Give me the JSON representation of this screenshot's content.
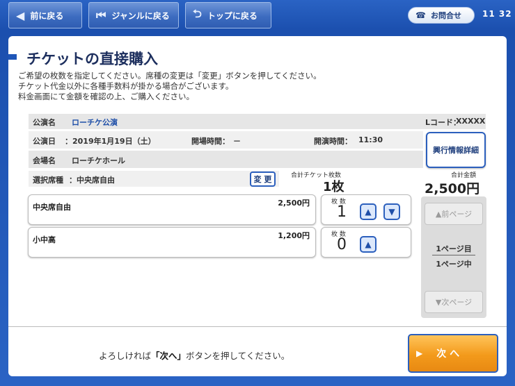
{
  "topbar": {
    "back_label": "前に戻る",
    "genre_back_label": "ジャンルに戻る",
    "top_back_label": "トップに戻る",
    "contact_label": "お問合せ",
    "clock": "11 32"
  },
  "page": {
    "title": "チケットの直接購入",
    "instructions": [
      "ご希望の枚数を指定してください。席種の変更は「変更」ボタンを押してください。",
      "チケット代金以外に各種手数料が掛かる場合がございます。",
      "料金画面にて金額を確認の上、ご購入ください。"
    ]
  },
  "event": {
    "name_label": "公演名",
    "name": "ローチケ公演",
    "lcode_label": "Lコード：",
    "lcode": "XXXXX",
    "date_label": "公演日",
    "date": "：2019年1月19日（土）",
    "open_label": "開場時間：",
    "open_time": "－",
    "start_label": "開演時間：",
    "start_time": "11:30",
    "venue_label": "会場名",
    "venue": "ローチケホール",
    "seat_label": "選択席種",
    "seat": "：中央席自由",
    "detail_button": "興行情報詳細",
    "change_button": "変 更"
  },
  "totals": {
    "count_label": "合計チケット枚数",
    "count": "1枚",
    "amount_label": "合計金額",
    "amount": "2,500円"
  },
  "tickets": [
    {
      "name": "中央席自由",
      "price": "2,500円",
      "qty_label": "枚 数",
      "qty": "1"
    },
    {
      "name": "小中高",
      "price": "1,200円",
      "qty_label": "枚 数",
      "qty": "0"
    }
  ],
  "pager": {
    "prev": "▲前ページ",
    "current": "1ページ目",
    "total": "1ページ中",
    "next": "▼次ページ"
  },
  "footer": {
    "msg_pre": "よろしければ",
    "msg_bold": "「次へ」",
    "msg_post": "ボタンを押してください。",
    "next_button": "次 へ"
  },
  "colors": {
    "accent": "#2b5fbd",
    "next": "#f39a1b",
    "background": "#2a63c4"
  }
}
